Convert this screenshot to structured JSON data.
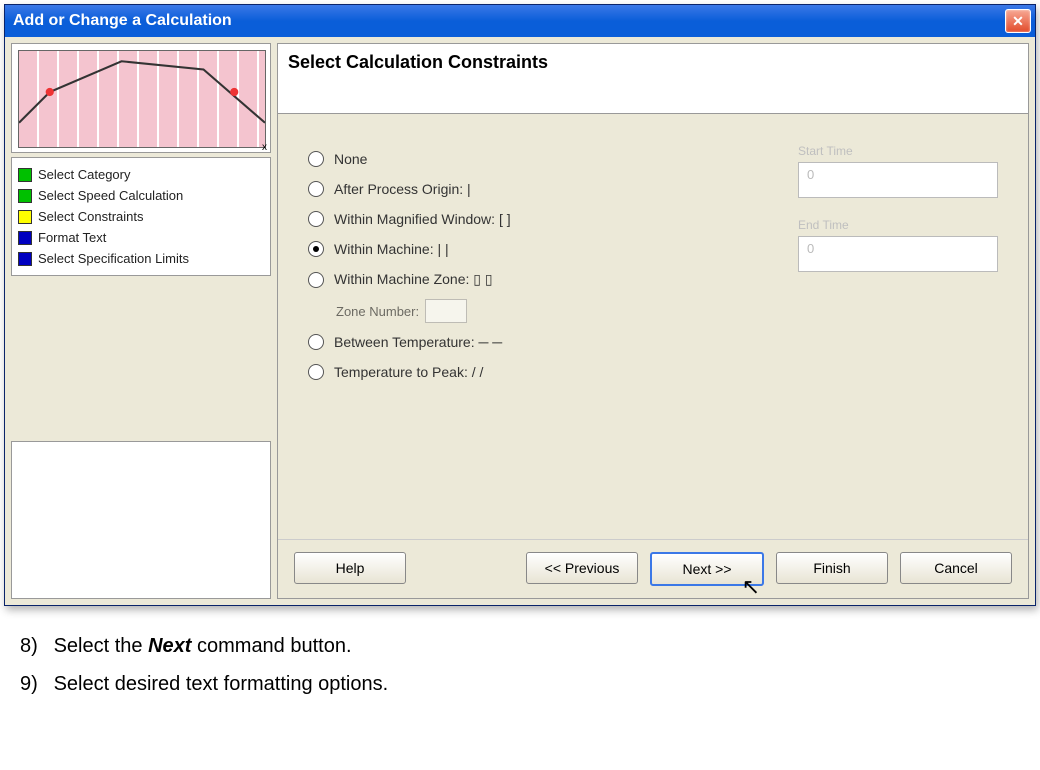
{
  "window": {
    "title": "Add or Change a Calculation"
  },
  "chart": {
    "axis_x": "x"
  },
  "steps": [
    {
      "color": "green",
      "label": "Select Category"
    },
    {
      "color": "green",
      "label": "Select Speed Calculation"
    },
    {
      "color": "yellow",
      "label": "Select Constraints"
    },
    {
      "color": "blue",
      "label": "Format Text"
    },
    {
      "color": "blue",
      "label": "Select Specification Limits"
    }
  ],
  "main": {
    "title": "Select Calculation Constraints"
  },
  "options": {
    "none": "None",
    "after_origin": "After Process Origin: |",
    "within_mag": "Within Magnified Window: [  ]",
    "within_machine": "Within Machine: |  |",
    "within_zone": "Within Machine Zone: ▯ ▯",
    "zone_sub_label": "Zone Number:",
    "between_temp": "Between Temperature: ─ ─",
    "temp_peak": "Temperature to Peak: /  /"
  },
  "side": {
    "label1": "Start Time",
    "val1": "0",
    "label2": "End Time",
    "val2": "0"
  },
  "buttons": {
    "help": "Help",
    "prev": "<< Previous",
    "next": "Next >>",
    "finish": "Finish",
    "cancel": "Cancel"
  },
  "instructions": {
    "item8_num": "8)",
    "item8_a": "Select the ",
    "item8_b": "Next",
    "item8_c": " command button.",
    "item9_num": "9)",
    "item9": "Select desired text formatting options."
  }
}
